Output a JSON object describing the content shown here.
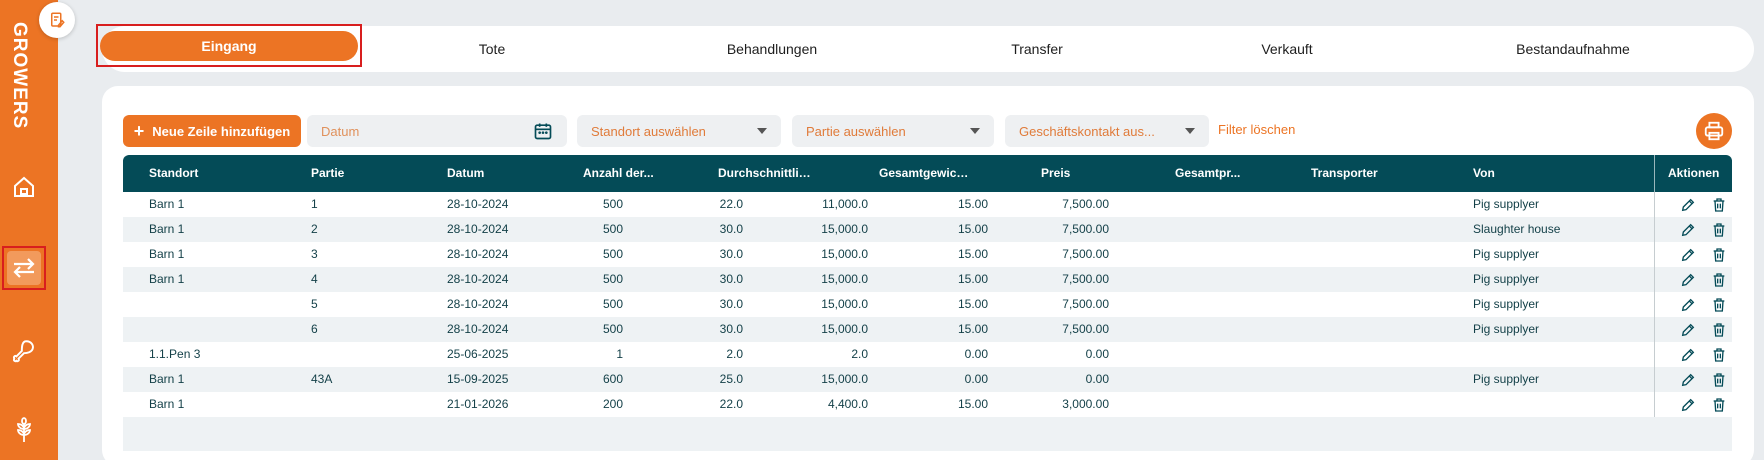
{
  "app": {
    "brand": "GROWERS"
  },
  "sidebar": {
    "items": [
      {
        "name": "home-icon"
      },
      {
        "name": "transfer-arrows-icon",
        "active": true
      },
      {
        "name": "meat-leg-icon"
      },
      {
        "name": "wheat-icon"
      }
    ]
  },
  "tabs": [
    {
      "label": "Eingang",
      "active": true
    },
    {
      "label": "Tote"
    },
    {
      "label": "Behandlungen"
    },
    {
      "label": "Transfer"
    },
    {
      "label": "Verkauft"
    },
    {
      "label": "Bestandaufnahme"
    }
  ],
  "toolbar": {
    "add_label": "Neue Zeile hinzufügen",
    "date_placeholder": "Datum",
    "location_placeholder": "Standort auswählen",
    "batch_placeholder": "Partie auswählen",
    "contact_placeholder": "Geschäftskontakt aus...",
    "clear_filter": "Filter löschen"
  },
  "table": {
    "headers": [
      "Standort",
      "Partie",
      "Datum",
      "Anzahl der...",
      "Durchschnittlic...",
      "Gesamtgewicht...",
      "Preis",
      "Gesamtpr...",
      "Transporter",
      "Von",
      "Aktionen"
    ],
    "rows": [
      [
        "Barn 1",
        "1",
        "28-10-2024",
        "500",
        "22.0",
        "11,000.0",
        "15.00",
        "7,500.00",
        "",
        "Pig supplyer"
      ],
      [
        "Barn 1",
        "2",
        "28-10-2024",
        "500",
        "30.0",
        "15,000.0",
        "15.00",
        "7,500.00",
        "",
        "Slaughter house"
      ],
      [
        "Barn 1",
        "3",
        "28-10-2024",
        "500",
        "30.0",
        "15,000.0",
        "15.00",
        "7,500.00",
        "",
        "Pig supplyer"
      ],
      [
        "Barn 1",
        "4",
        "28-10-2024",
        "500",
        "30.0",
        "15,000.0",
        "15.00",
        "7,500.00",
        "",
        "Pig supplyer"
      ],
      [
        "",
        "5",
        "28-10-2024",
        "500",
        "30.0",
        "15,000.0",
        "15.00",
        "7,500.00",
        "",
        "Pig supplyer"
      ],
      [
        "",
        "6",
        "28-10-2024",
        "500",
        "30.0",
        "15,000.0",
        "15.00",
        "7,500.00",
        "",
        "Pig supplyer"
      ],
      [
        "1.1.Pen 3",
        "",
        "25-06-2025",
        "1",
        "2.0",
        "2.0",
        "0.00",
        "0.00",
        "",
        ""
      ],
      [
        "Barn 1",
        "43A",
        "15-09-2025",
        "600",
        "25.0",
        "15,000.0",
        "0.00",
        "0.00",
        "",
        "Pig supplyer"
      ],
      [
        "Barn 1",
        "",
        "21-01-2026",
        "200",
        "22.0",
        "4,400.0",
        "15.00",
        "3,000.00",
        "",
        ""
      ]
    ]
  },
  "colors": {
    "brand_orange": "#ec7424",
    "table_header": "#044b57",
    "highlight_red": "#d81e1e"
  }
}
